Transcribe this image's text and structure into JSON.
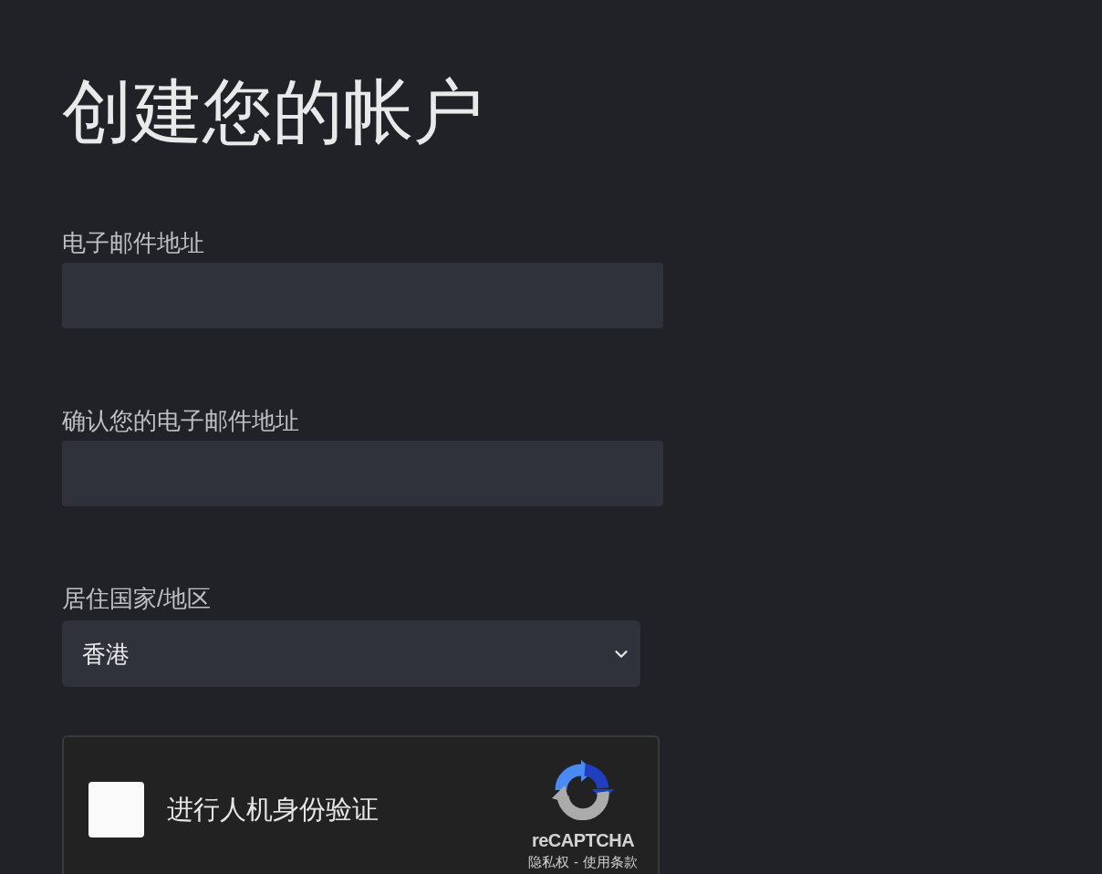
{
  "page": {
    "title": "创建您的帐户"
  },
  "fields": [
    {
      "kind": "text",
      "label": "电子邮件地址"
    },
    {
      "kind": "text",
      "label": "确认您的电子邮件地址"
    },
    {
      "kind": "select",
      "label": "居住国家/地区",
      "value": "香港"
    }
  ],
  "captcha": {
    "checked": false,
    "label": "进行人机身份验证",
    "brand": "reCAPTCHA",
    "links": [
      "隐私权",
      "使用条款"
    ],
    "separator": "-"
  }
}
